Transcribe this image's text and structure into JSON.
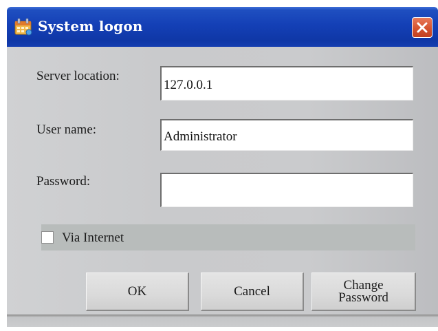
{
  "window": {
    "title": "System logon"
  },
  "form": {
    "server_label": "Server location:",
    "server_value": "127.0.0.1",
    "user_label": "User name:",
    "user_value": "Administrator",
    "password_label": "Password:",
    "password_value": "",
    "via_internet_label": "Via Internet",
    "via_internet_checked": false
  },
  "buttons": {
    "ok": "OK",
    "cancel": "Cancel",
    "change_password_line1": "Change",
    "change_password_line2": "Password"
  },
  "icons": {
    "app": "calendar-app-icon",
    "close": "close-icon"
  },
  "colors": {
    "titlebar": "#1440b6",
    "close_button": "#d5532f"
  }
}
